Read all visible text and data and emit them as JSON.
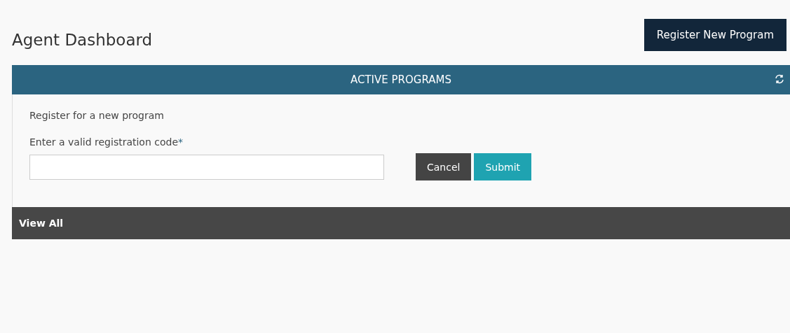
{
  "page": {
    "title": "Agent Dashboard"
  },
  "header_button": {
    "label": "Register New Program"
  },
  "panel": {
    "title": "ACTIVE PROGRAMS",
    "form": {
      "heading": "Register for a new program",
      "field_label": "Enter a valid registration code",
      "required_mark": "*"
    },
    "buttons": [
      {
        "label": "Cancel",
        "kind": "secondary"
      },
      {
        "label": "Submit",
        "kind": "primary"
      }
    ],
    "footer_link": "View All"
  }
}
